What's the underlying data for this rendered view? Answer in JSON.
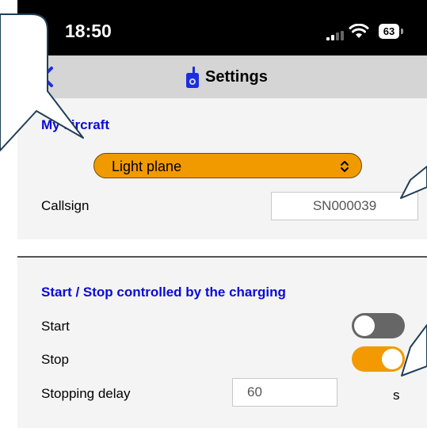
{
  "status_bar": {
    "time": "18:50",
    "battery": "63",
    "signal_icon": "cellular-signal-icon",
    "wifi_icon": "wifi-icon"
  },
  "nav": {
    "title": "Settings",
    "back_icon": "chevron-left-icon",
    "app_icon": "handheld-device-icon",
    "accent": "#1a2fe0"
  },
  "aircraft_section": {
    "title": "My aircraft",
    "type_select": {
      "value": "Light plane",
      "icon": "select-updown-chevron-icon",
      "color": "#f19a00"
    },
    "callsign": {
      "label": "Callsign",
      "value": "SN000039"
    }
  },
  "charging_section": {
    "title": "Start / Stop controlled by the charging",
    "start": {
      "label": "Start",
      "enabled": false
    },
    "stop": {
      "label": "Stop",
      "enabled": true
    },
    "stopping_delay": {
      "label": "Stopping delay",
      "value": "60",
      "unit": "s"
    }
  },
  "colors": {
    "section_title": "#0a0ad8",
    "toggle_on": "#f39a00",
    "toggle_off": "#666666"
  }
}
